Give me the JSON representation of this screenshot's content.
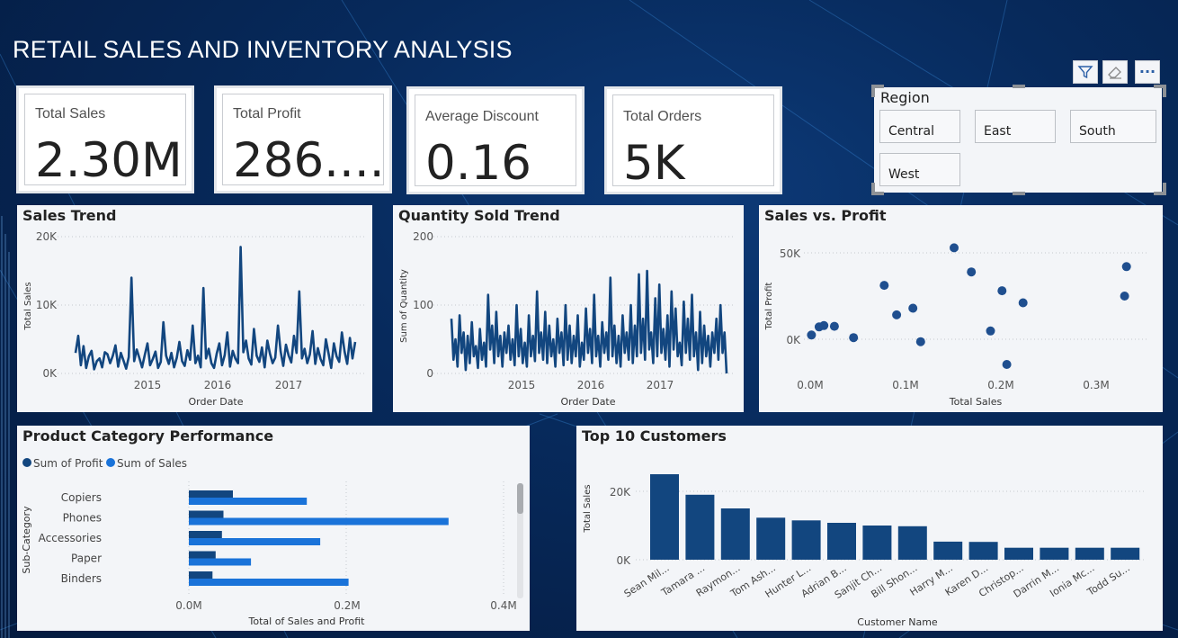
{
  "title": "RETAIL SALES AND INVENTORY ANALYSIS",
  "kpis": [
    {
      "label": "Total Sales",
      "value": "2.30M"
    },
    {
      "label": "Total Profit",
      "value": "286...."
    },
    {
      "label": "Average Discount",
      "value": "0.16"
    },
    {
      "label": "Total Orders",
      "value": "5K"
    }
  ],
  "toolbar": {
    "icons": [
      "filter-icon",
      "eraser-icon",
      "more-options-icon"
    ],
    "more_label": "···"
  },
  "slicer": {
    "title": "Region",
    "options": [
      "Central",
      "East",
      "South",
      "West"
    ]
  },
  "colors": {
    "dark_blue": "#12467f",
    "light_blue": "#1a73d9",
    "panel": "#f3f5f8"
  },
  "chart_data": [
    {
      "type": "line",
      "title": "Sales Trend",
      "xlabel": "Order Date",
      "ylabel": "Total Sales",
      "yticks": [
        "0K",
        "10K",
        "20K"
      ],
      "xticks": [
        "2015",
        "2016",
        "2017"
      ],
      "ylim": [
        0,
        20000
      ],
      "x_range": [
        "2014-01-01",
        "2017-12-31"
      ],
      "series": [
        {
          "values": [
            3000,
            5500,
            1200,
            4000,
            800,
            2500,
            3300,
            600,
            1800,
            2200,
            900,
            3100,
            2800,
            1500,
            2600,
            4100,
            1000,
            3000,
            1900,
            700,
            2400,
            14000,
            1800,
            3500,
            2200,
            900,
            2700,
            4400,
            1200,
            2100,
            3200,
            800,
            1700,
            7500,
            2600,
            1400,
            3000,
            900,
            2300,
            4600,
            1800,
            1100,
            3400,
            2000,
            7000,
            1500,
            2600,
            900,
            12500,
            2200,
            3600,
            1500,
            800,
            2900,
            4400,
            1200,
            2700,
            6000,
            1000,
            3300,
            2200,
            1500,
            18500,
            3100,
            4800,
            2200,
            1300,
            6500,
            2600,
            1700,
            3800,
            900,
            4800,
            2900,
            1500,
            2300,
            7000,
            3200,
            1100,
            4200,
            2600,
            1600,
            5500,
            3000,
            12000,
            2200,
            3600,
            1500,
            2800,
            6200,
            1400,
            3700,
            2100,
            1200,
            5000,
            2900,
            800,
            4400,
            2500,
            1700,
            6000,
            3200,
            1400,
            5200,
            2200,
            4600
          ]
        }
      ]
    },
    {
      "type": "line",
      "title": "Quantity Sold Trend",
      "xlabel": "Order Date",
      "ylabel": "Sum of Quantity",
      "yticks": [
        "0",
        "100",
        "200"
      ],
      "xticks": [
        "2015",
        "2016",
        "2017"
      ],
      "ylim": [
        0,
        200
      ],
      "x_range": [
        "2014-01-01",
        "2017-12-31"
      ],
      "series": [
        {
          "values": [
            80,
            20,
            50,
            10,
            85,
            30,
            60,
            5,
            55,
            15,
            75,
            25,
            40,
            8,
            65,
            20,
            45,
            10,
            115,
            35,
            70,
            15,
            90,
            25,
            55,
            10,
            60,
            30,
            70,
            20,
            50,
            12,
            100,
            25,
            65,
            15,
            45,
            10,
            85,
            25,
            55,
            18,
            120,
            30,
            60,
            20,
            90,
            15,
            70,
            25,
            50,
            10,
            80,
            30,
            60,
            12,
            100,
            20,
            70,
            15,
            55,
            25,
            85,
            10,
            45,
            20,
            95,
            30,
            65,
            15,
            115,
            25,
            55,
            10,
            75,
            30,
            60,
            20,
            140,
            25,
            70,
            15,
            55,
            10,
            85,
            30,
            60,
            20,
            100,
            15,
            70,
            25,
            145,
            30,
            80,
            20,
            150,
            35,
            60,
            15,
            110,
            25,
            130,
            30,
            65,
            20,
            85,
            10,
            120,
            35,
            95,
            25,
            45,
            12,
            105,
            30,
            80,
            20,
            115,
            25,
            60,
            5,
            90,
            15,
            70,
            25,
            55,
            10,
            60,
            30,
            80,
            20,
            100,
            30,
            60,
            0
          ]
        }
      ]
    },
    {
      "type": "scatter",
      "title": "Sales vs. Profit",
      "xlabel": "Total Sales",
      "ylabel": "Total Profit",
      "xticks": [
        "0.0M",
        "0.1M",
        "0.2M",
        "0.3M"
      ],
      "yticks": [
        "0K",
        "50K"
      ],
      "xlim": [
        -0.02,
        0.35
      ],
      "ylim": [
        -25000,
        75000
      ],
      "series": [
        {
          "x": [
            0.001,
            0.009,
            0.014,
            0.025,
            0.045,
            0.077,
            0.09,
            0.107,
            0.115,
            0.15,
            0.168,
            0.188,
            0.2,
            0.205,
            0.222,
            0.328,
            0.33
          ],
          "y": [
            1000,
            7000,
            8000,
            7500,
            -1000,
            38000,
            16000,
            21000,
            -4000,
            66000,
            48000,
            4000,
            34000,
            -21000,
            25000,
            30000,
            52000
          ]
        }
      ]
    },
    {
      "type": "bar",
      "title": "Product Category Performance",
      "orientation": "horizontal",
      "xlabel": "Total of Sales and Profit",
      "ylabel": "Sub-Category",
      "xticks": [
        "0.0M",
        "0.2M",
        "0.4M"
      ],
      "xlim": [
        0,
        0.4
      ],
      "categories": [
        "Copiers",
        "Phones",
        "Accessories",
        "Paper",
        "Binders"
      ],
      "series": [
        {
          "name": "Sum of Profit",
          "values": [
            0.056,
            0.044,
            0.042,
            0.034,
            0.03
          ]
        },
        {
          "name": "Sum of Sales",
          "values": [
            0.15,
            0.33,
            0.167,
            0.079,
            0.203
          ]
        }
      ]
    },
    {
      "type": "bar",
      "title": "Top 10 Customers",
      "xlabel": "Customer Name",
      "ylabel": "Total Sales",
      "yticks": [
        "0K",
        "20K"
      ],
      "ylim": [
        0,
        28000
      ],
      "categories": [
        "Sean Mil...",
        "Tamara ...",
        "Raymon...",
        "Tom Ash...",
        "Hunter L...",
        "Adrian B...",
        "Sanjit Ch...",
        "Bill Shon...",
        "Harry M...",
        "Karen D...",
        "Christop...",
        "Darrin M...",
        "Ionia Mc...",
        "Todd Su..."
      ],
      "values": [
        25000,
        19000,
        15000,
        12300,
        11500,
        10800,
        10000,
        9800,
        5300,
        5200,
        3500,
        3500,
        3500,
        3500
      ]
    }
  ]
}
